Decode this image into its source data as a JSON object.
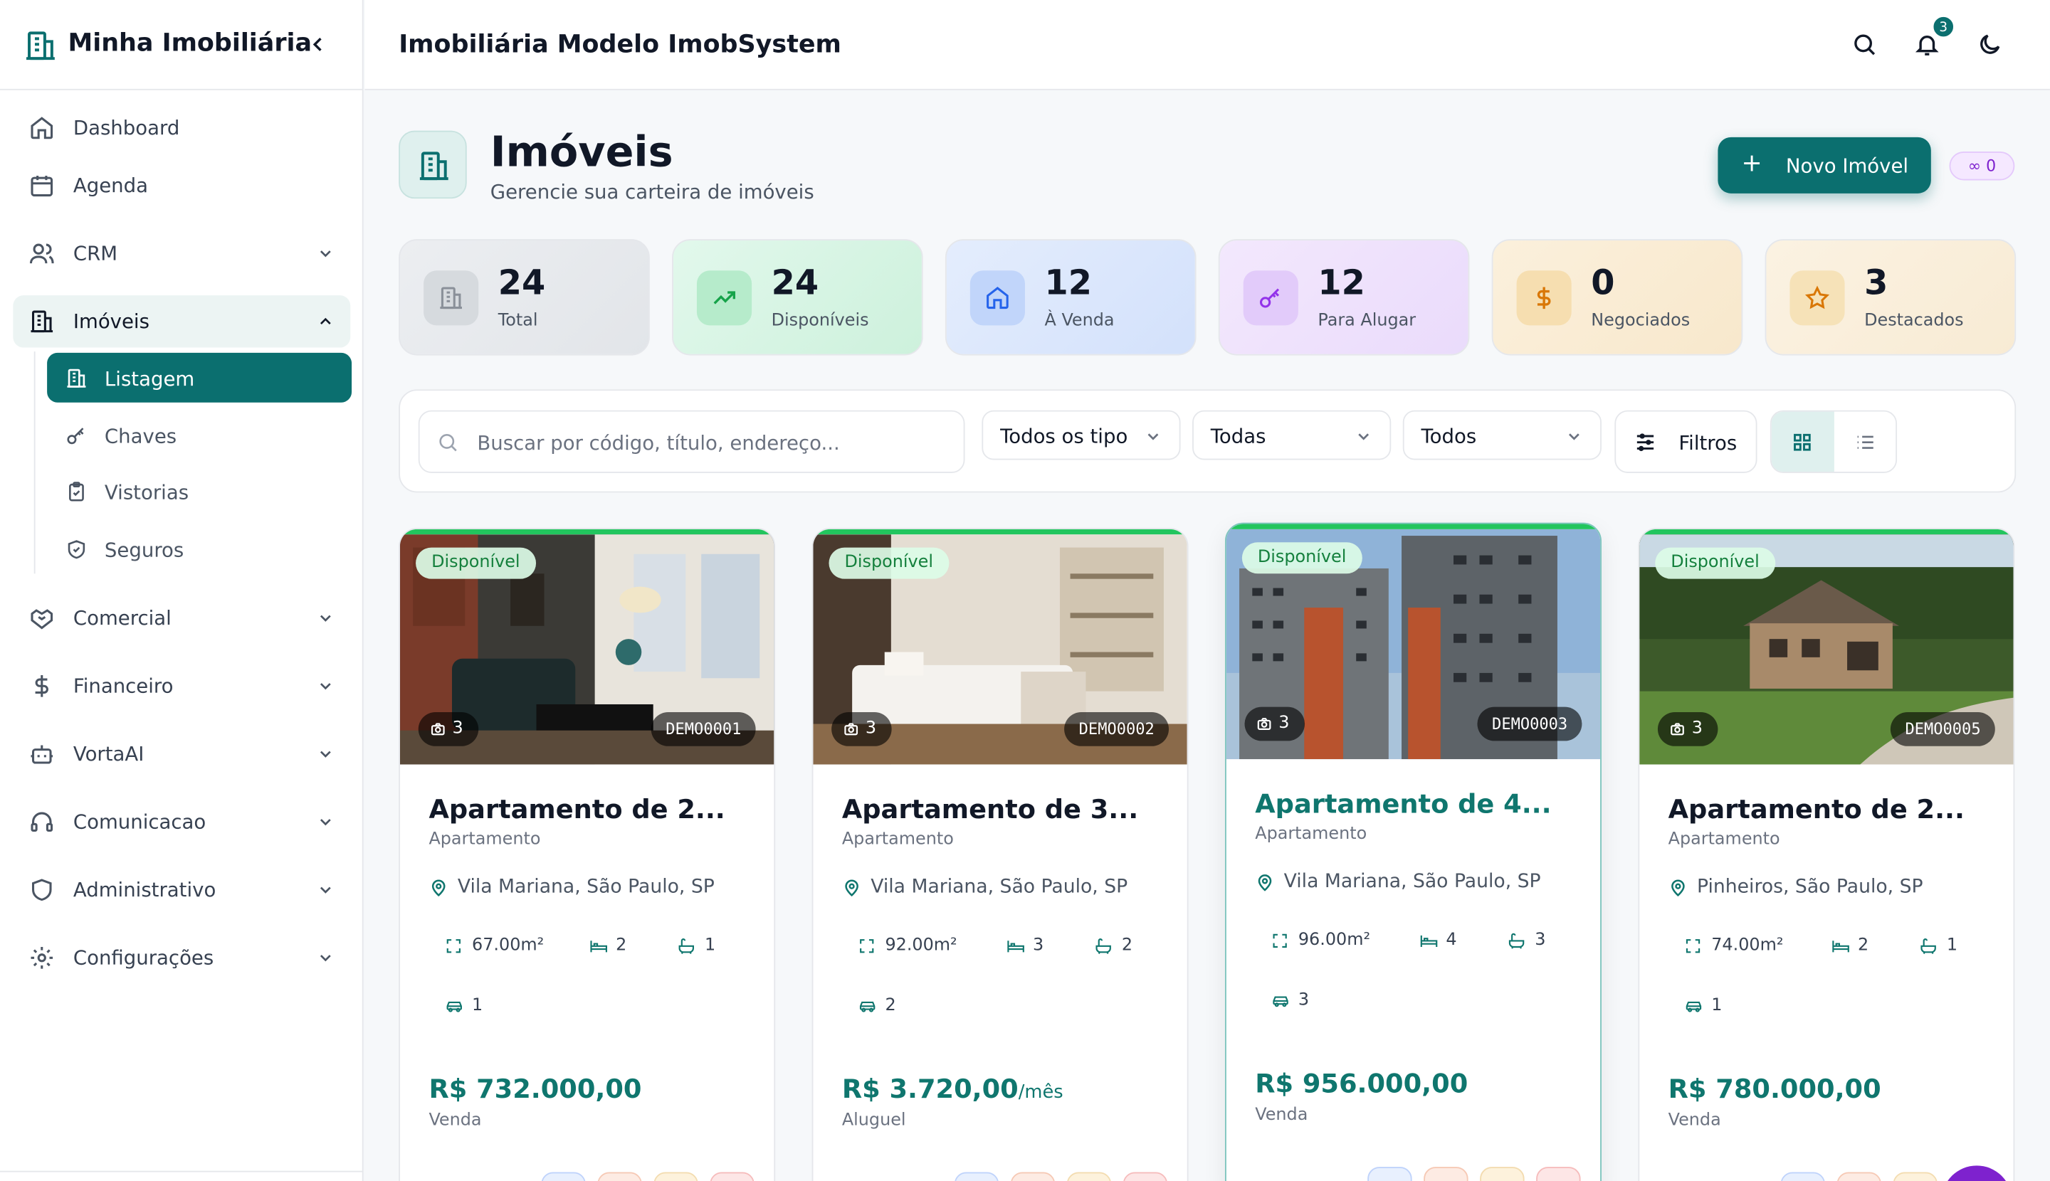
{
  "sidebar": {
    "brand": "Minha Imobiliária",
    "items": [
      {
        "label": "Dashboard",
        "icon": "home-icon"
      },
      {
        "label": "Agenda",
        "icon": "calendar-icon"
      },
      {
        "label": "CRM",
        "icon": "users-icon"
      },
      {
        "label": "Imóveis",
        "icon": "building-icon"
      },
      {
        "label": "Comercial",
        "icon": "handshake-icon"
      },
      {
        "label": "Financeiro",
        "icon": "dollar-icon"
      },
      {
        "label": "VortaAI",
        "icon": "bot-icon"
      },
      {
        "label": "Comunicacao",
        "icon": "headset-icon"
      },
      {
        "label": "Administrativo",
        "icon": "shield-icon"
      },
      {
        "label": "Configurações",
        "icon": "gear-icon"
      }
    ],
    "sub_items": [
      {
        "label": "Listagem",
        "icon": "building-icon"
      },
      {
        "label": "Chaves",
        "icon": "key-icon"
      },
      {
        "label": "Vistorias",
        "icon": "clipboard-icon"
      },
      {
        "label": "Seguros",
        "icon": "shield-check-icon"
      }
    ]
  },
  "header": {
    "title": "Imobiliária Modelo ImobSystem",
    "notifications": "3"
  },
  "page": {
    "title": "Imóveis",
    "subtitle": "Gerencie sua carteira de imóveis",
    "new_button": "Novo Imóvel",
    "mini_badge": "∞ 0"
  },
  "stats": [
    {
      "value": "24",
      "label": "Total",
      "color": "#6b7280"
    },
    {
      "value": "24",
      "label": "Disponíveis",
      "color": "#16a34a"
    },
    {
      "value": "12",
      "label": "À Venda",
      "color": "#2563eb"
    },
    {
      "value": "12",
      "label": "Para Alugar",
      "color": "#9333ea"
    },
    {
      "value": "0",
      "label": "Negociados",
      "color": "#d97706"
    },
    {
      "value": "3",
      "label": "Destacados",
      "color": "#d97706"
    }
  ],
  "filters": {
    "search_placeholder": "Buscar por código, título, endereço...",
    "type": "Todos os tipo",
    "status": "Todas",
    "purpose": "Todos",
    "filters_button": "Filtros"
  },
  "cards": [
    {
      "status": "Disponível",
      "photos": "3",
      "code": "DEMO0001",
      "title": "Apartamento de 2...",
      "type": "Apartamento",
      "location": "Vila Mariana, São Paulo, SP",
      "area": "67.00m²",
      "beds": "2",
      "baths": "1",
      "parking": "1",
      "price": "R$ 732.000,00",
      "price_suffix": "",
      "purpose": "Venda"
    },
    {
      "status": "Disponível",
      "photos": "3",
      "code": "DEMO0002",
      "title": "Apartamento de 3...",
      "type": "Apartamento",
      "location": "Vila Mariana, São Paulo, SP",
      "area": "92.00m²",
      "beds": "3",
      "baths": "2",
      "parking": "2",
      "price": "R$ 3.720,00",
      "price_suffix": "/mês",
      "purpose": "Aluguel"
    },
    {
      "status": "Disponível",
      "photos": "3",
      "code": "DEMO0003",
      "title": "Apartamento de 4...",
      "type": "Apartamento",
      "location": "Vila Mariana, São Paulo, SP",
      "area": "96.00m²",
      "beds": "4",
      "baths": "3",
      "parking": "3",
      "price": "R$ 956.000,00",
      "price_suffix": "",
      "purpose": "Venda"
    },
    {
      "status": "Disponível",
      "photos": "3",
      "code": "DEMO0005",
      "title": "Apartamento de 2...",
      "type": "Apartamento",
      "location": "Pinheiros, São Paulo, SP",
      "area": "74.00m²",
      "beds": "2",
      "baths": "1",
      "parking": "1",
      "price": "R$ 780.000,00",
      "price_suffix": "",
      "purpose": "Venda"
    }
  ],
  "colors": {
    "brand": "#0b6f6f",
    "available": "#22c55e",
    "price": "#0f766e"
  }
}
